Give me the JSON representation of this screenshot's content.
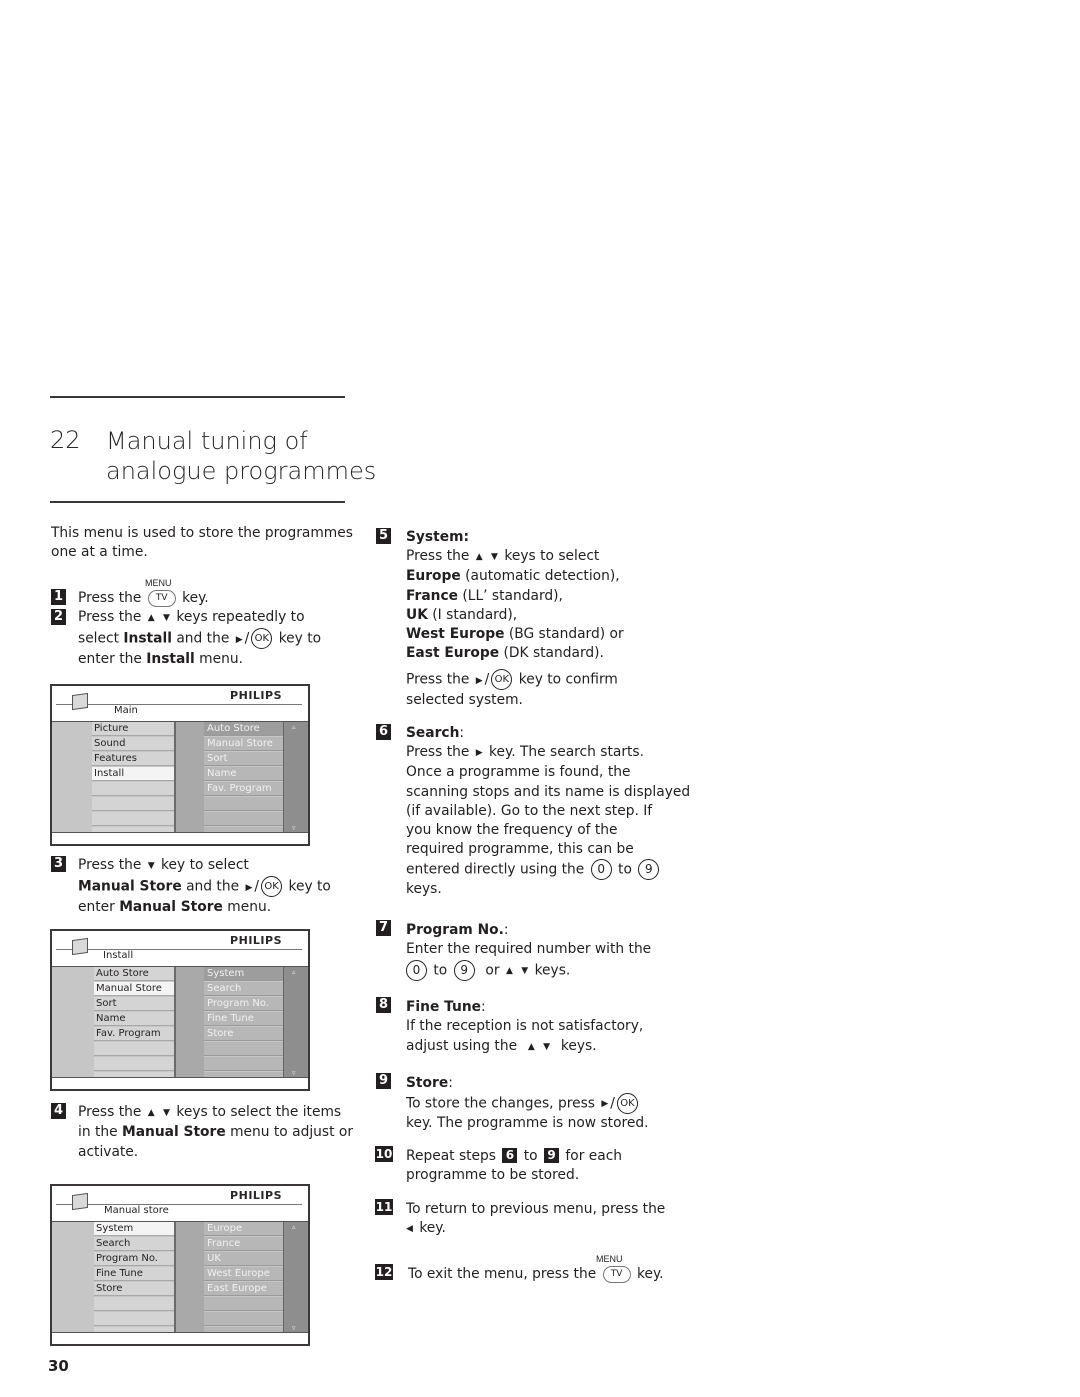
{
  "section": {
    "number": "22",
    "title_line1": "Manual tuning of",
    "title_line2": "analogue programmes"
  },
  "intro": "This menu is used to store the programmes one at a time.",
  "intro_line1": "This menu is used to store the programmes",
  "intro_line2": "one at a time.",
  "keys": {
    "menu_label": "MENU",
    "tv": "TV",
    "ok": "OK",
    "zero": "0",
    "nine": "9",
    "up": "▲",
    "down": "▼",
    "right": "▶",
    "left": "◀",
    "slash": "/"
  },
  "steps": [
    {
      "n": "1",
      "text": "Press the [MENU/TV] key."
    },
    {
      "n": "2",
      "text": "Press the ▲ ▼ keys repeatedly to select Install and the ▶ / OK key to enter the Install menu."
    },
    {
      "n": "3",
      "text": "Press the ▼ key to select Manual Store and the ▶ / OK key to enter Manual Store menu."
    },
    {
      "n": "4",
      "text": "Press the ▲ ▼ keys to select the items in the Manual Store menu to adjust or activate."
    },
    {
      "n": "5",
      "heading": "System:",
      "text": "Press the ▲ ▼ keys to select Europe (automatic detection), France (LL' standard), UK (I standard), West Europe (BG standard) or East Europe (DK standard). Press the ▶ / OK key to confirm selected system."
    },
    {
      "n": "6",
      "heading": "Search",
      "text": "Press the ▶ key. The search starts. Once a programme is found, the scanning stops and its name is displayed (if available). Go to the next step. If you know the frequency of the required programme, this can be entered directly using the 0 to 9 keys."
    },
    {
      "n": "7",
      "heading": "Program No.",
      "text": "Enter the required number with the 0 to 9 or ▲ ▼ keys."
    },
    {
      "n": "8",
      "heading": "Fine Tune",
      "text": "If the reception is not satisfactory, adjust using the ▲ ▼ keys."
    },
    {
      "n": "9",
      "heading": "Store",
      "text": "To store the changes, press ▶ / OK key. The programme is now stored."
    },
    {
      "n": "10",
      "text": "Repeat steps 6 to 9 for each programme to be stored."
    },
    {
      "n": "11",
      "text": "To return to previous menu, press the ◀ key."
    },
    {
      "n": "12",
      "text": "To exit the menu, press the MENU/TV key."
    }
  ],
  "t": {
    "press_the": "Press the",
    "key_dot": "key.",
    "keys_rep_to": "keys repeatedly to",
    "select": "select",
    "install": "Install",
    "and_the": "and the",
    "key_to": "key to",
    "enter_the": "enter the",
    "menu_dot": "menu.",
    "key_to_select": "key to select",
    "manual_store": "Manual Store",
    "enter": "enter",
    "keys_to_select_items": "keys to select the items",
    "in_the": "in the",
    "menu_to_adjust": "menu to adjust or",
    "activate": "activate.",
    "system_h": "System:",
    "keys_to_select": "keys to select",
    "europe": "Europe",
    "europe_d": "(automatic detection),",
    "france": "France",
    "france_d": "(LL’ standard),",
    "uk": "UK",
    "uk_d": "(I standard),",
    "west": "West Europe",
    "west_d": "(BG standard)  or",
    "east": "East Europe",
    "east_d": "(DK standard).",
    "key_confirm": "key to confirm",
    "selected_system": "selected system.",
    "search_h": "Search",
    "colon": ":",
    "s6_l1": "key. The search starts.",
    "s6_l2": "Once a programme is found, the",
    "s6_l3": "scanning stops and its name is displayed",
    "s6_l4": "(if available). Go to the next step. If",
    "s6_l5": "you know the frequency of the",
    "s6_l6": "required programme, this can be",
    "s6_l7": "entered directly using the",
    "to": "to",
    "keys_dot": "keys.",
    "progno_h": "Program No.",
    "s7_l1": "Enter the required number with the",
    "or": "or",
    "finetune_h": "Fine Tune",
    "s8_l1": "If the reception is not satisfactory,",
    "s8_l2": "adjust using the",
    "store_h": "Store",
    "s9_l1": "To store the changes, press",
    "s9_l2": "key. The programme is now stored.",
    "s10_a": "Repeat steps",
    "s10_b": "for each",
    "s10_l2": "programme to be stored.",
    "s11_l1": "To return to previous menu, press the",
    "s12_l1": "To exit the menu, press the"
  },
  "menus": [
    {
      "brand": "PHILIPS",
      "breadcrumb": "Main",
      "left_items": [
        "Picture",
        "Sound",
        "Features",
        "Install",
        "",
        "",
        "",
        ""
      ],
      "selected_left": "Install",
      "right_items": [
        "Auto Store",
        "Manual Store",
        "Sort",
        "Name",
        "Fav. Program",
        "",
        "",
        ""
      ]
    },
    {
      "brand": "PHILIPS",
      "breadcrumb": "Install",
      "left_items": [
        "Auto Store",
        "Manual Store",
        "Sort",
        "Name",
        "Fav. Program",
        "",
        "",
        ""
      ],
      "selected_left": "Manual Store",
      "right_items": [
        "System",
        "Search",
        "Program No.",
        "Fine Tune",
        "Store",
        "",
        "",
        ""
      ]
    },
    {
      "brand": "PHILIPS",
      "breadcrumb": "Manual store",
      "left_items": [
        "System",
        "Search",
        "Program No.",
        "Fine Tune",
        "Store",
        "",
        "",
        ""
      ],
      "selected_left": "System",
      "right_items": [
        "Europe",
        "France",
        "UK",
        "West Europe",
        "East Europe",
        "",
        "",
        ""
      ]
    }
  ],
  "scroll_up": "▵",
  "scroll_down": "▿",
  "page_number": "30"
}
